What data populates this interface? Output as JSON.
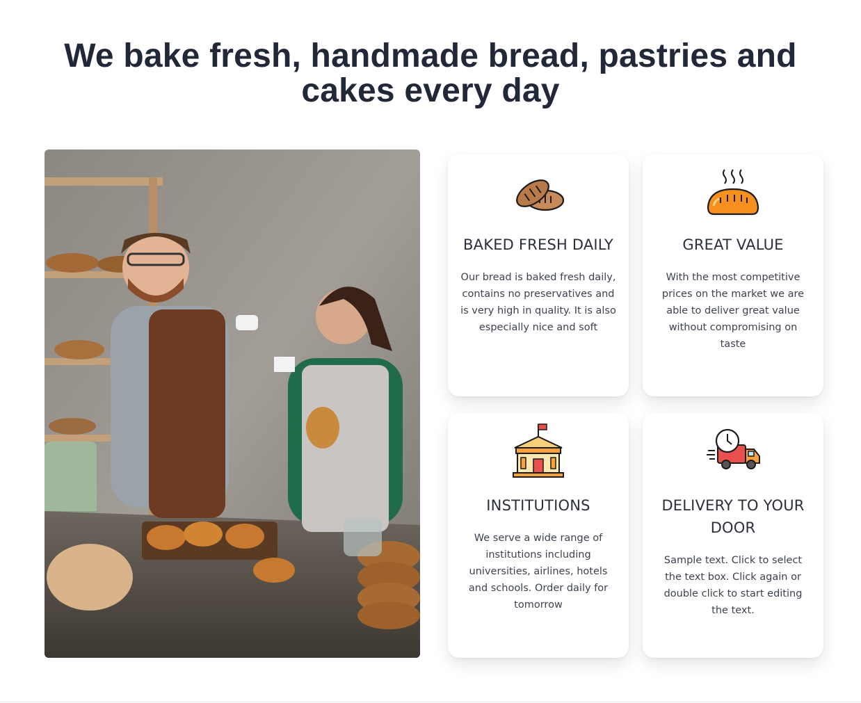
{
  "section": {
    "headline": "We bake fresh, handmade bread, pastries and cakes every day",
    "photo": {
      "subject": "bakers-photo"
    }
  },
  "features": [
    {
      "icon": "bread-loaves-icon",
      "title": "BAKED FRESH DAILY",
      "text": "Our bread is baked fresh daily, contains no preservatives and is very high in quality. It is also especially nice and soft"
    },
    {
      "icon": "hot-bread-icon",
      "title": "GREAT VALUE",
      "text": "With the most competitive prices on the market we are able to deliver great value without compromising on taste"
    },
    {
      "icon": "institution-building-icon",
      "title": "INSTITUTIONS",
      "text": "We serve a wide range of institutions including universities, airlines, hotels and schools. Order daily for tomorrow"
    },
    {
      "icon": "delivery-truck-icon",
      "title": "DELIVERY TO YOUR DOOR",
      "text": "Sample text. Click to select the text box. Click again or double click to start editing the text."
    }
  ],
  "colors": {
    "heading": "#212837",
    "card_bg": "#ffffff",
    "icon_orange": "#f7901e",
    "icon_brown": "#b97a4a",
    "icon_red": "#e8504e"
  }
}
